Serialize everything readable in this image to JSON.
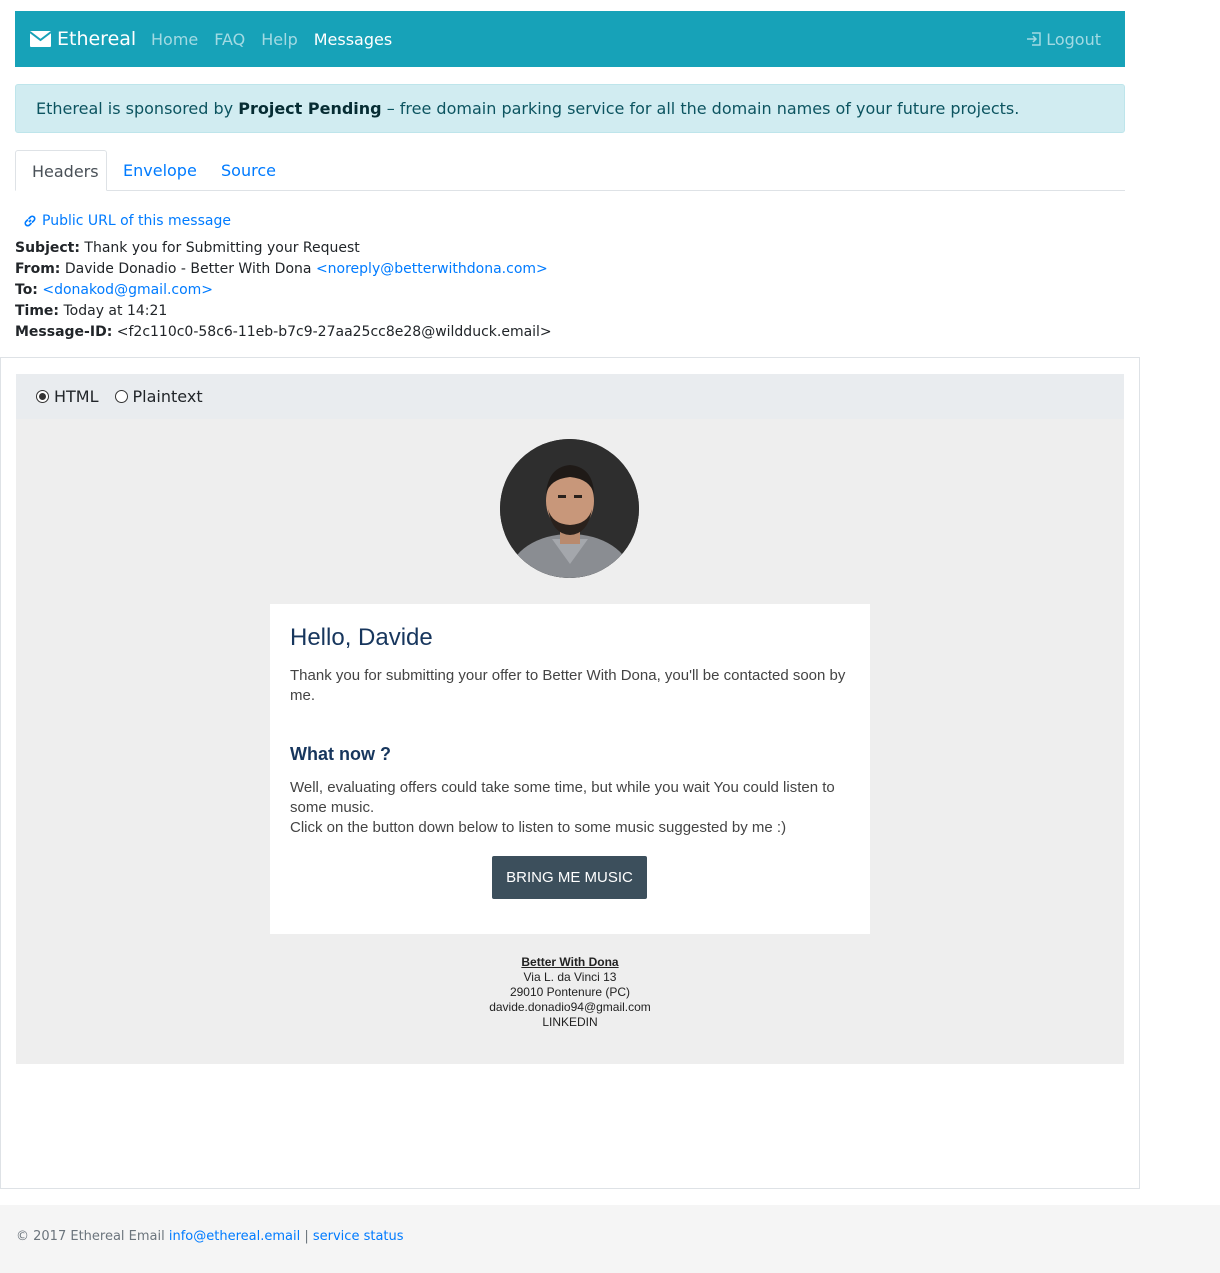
{
  "navbar": {
    "brand": "Ethereal",
    "links": [
      "Home",
      "FAQ",
      "Help",
      "Messages"
    ],
    "logout": "Logout"
  },
  "alert": {
    "prefix": "Ethereal is sponsored by ",
    "sponsor": "Project Pending",
    "suffix": " – free domain parking service for all the domain names of your future projects."
  },
  "tabs": [
    "Headers",
    "Envelope",
    "Source"
  ],
  "public_url": "Public URL of this message",
  "headers": {
    "subject_label": "Subject:",
    "subject": "Thank you for Submitting your Request",
    "from_label": "From:",
    "from_name": "Davide Donadio - Better With Dona",
    "from_email": "<noreply@betterwithdona.com>",
    "to_label": "To:",
    "to_email": "<donakod@gmail.com>",
    "time_label": "Time:",
    "time": "Today at 14:21",
    "msgid_label": "Message-ID:",
    "msgid": "<f2c110c0-58c6-11eb-b7c9-27aa25cc8e28@wildduck.email>"
  },
  "view_toggle": {
    "html": "HTML",
    "plaintext": "Plaintext",
    "selected": "HTML"
  },
  "email": {
    "greeting": "Hello, Davide",
    "intro": "Thank you for submitting your offer to Better With Dona, you'll be contacted soon by me.",
    "subheading": "What now ?",
    "body_line1": "Well, evaluating offers could take some time, but while you wait You could listen to some music.",
    "body_line2": "Click on the button down below to listen to some music suggested by me :)",
    "button": "BRING ME MUSIC",
    "footer": {
      "company": "Better With Dona",
      "street": "Via L. da Vinci 13",
      "city": "29010 Pontenure (PC)",
      "email": "davide.donadio94@gmail.com",
      "social": "LINKEDIN"
    }
  },
  "page_footer": {
    "copyright": "© 2017 Ethereal Email ",
    "email": "info@ethereal.email",
    "sep": " | ",
    "status": "service status"
  },
  "colors": {
    "navbar": "#17a2b8",
    "link": "#007bff",
    "button": "#3c4f5c",
    "heading": "#17365d"
  }
}
